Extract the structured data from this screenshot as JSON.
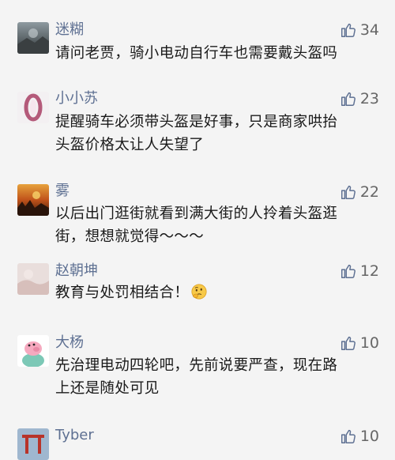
{
  "comments": [
    {
      "name": "迷糊",
      "likes": "34",
      "text": [
        "请问老贾，骑小电动自行车也需要戴头盔吗"
      ]
    },
    {
      "name": "小小苏",
      "likes": "23",
      "text": [
        "提醒骑车必须带头盔是好事，只是商家哄抬",
        "头盔价格太让人失望了"
      ]
    },
    {
      "name": "雾",
      "likes": "22",
      "text": [
        "以后出门逛街就看到满大街的人拎着头盔逛",
        "街，想想就觉得～～～"
      ]
    },
    {
      "name": "赵朝坤",
      "likes": "12",
      "text": [
        "教育与处罚相结合！"
      ],
      "emoji": "thinking-emoji"
    },
    {
      "name": "大杨",
      "likes": "10",
      "text": [
        "先治理电动四轮吧，先前说要严查，现在路",
        "上还是随处可见"
      ]
    },
    {
      "name": "Tyber",
      "likes": "10",
      "text": []
    }
  ],
  "colors": {
    "name": "#5e7092",
    "text": "#1a1a1a",
    "like": "#5e7092",
    "background": "#f4f4f4"
  }
}
